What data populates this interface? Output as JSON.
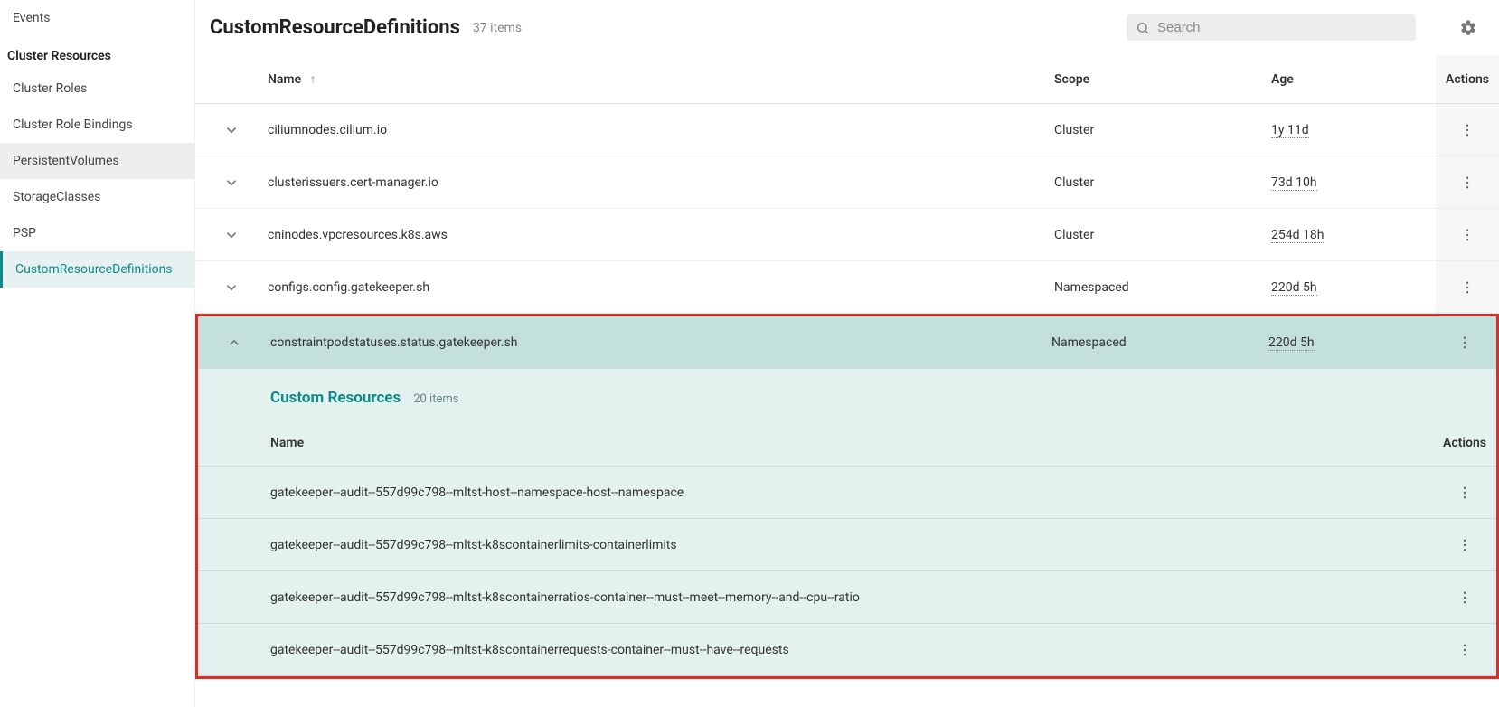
{
  "sidebar": {
    "events": "Events",
    "section": "Cluster Resources",
    "items": [
      {
        "label": "Cluster Roles",
        "active": false,
        "highlight": false
      },
      {
        "label": "Cluster Role Bindings",
        "active": false,
        "highlight": false
      },
      {
        "label": "PersistentVolumes",
        "active": false,
        "highlight": true
      },
      {
        "label": "StorageClasses",
        "active": false,
        "highlight": false
      },
      {
        "label": "PSP",
        "active": false,
        "highlight": false
      },
      {
        "label": "CustomResourceDefinitions",
        "active": true,
        "highlight": false
      }
    ]
  },
  "header": {
    "title": "CustomResourceDefinitions",
    "count": "37 items",
    "search_placeholder": "Search"
  },
  "columns": {
    "name": "Name",
    "scope": "Scope",
    "age": "Age",
    "actions": "Actions"
  },
  "rows": [
    {
      "name": "ciliumnodes.cilium.io",
      "scope": "Cluster",
      "age": "1y 11d",
      "expanded": false
    },
    {
      "name": "clusterissuers.cert-manager.io",
      "scope": "Cluster",
      "age": "73d 10h",
      "expanded": false
    },
    {
      "name": "cninodes.vpcresources.k8s.aws",
      "scope": "Cluster",
      "age": "254d 18h",
      "expanded": false
    },
    {
      "name": "configs.config.gatekeeper.sh",
      "scope": "Namespaced",
      "age": "220d 5h",
      "expanded": false
    },
    {
      "name": "constraintpodstatuses.status.gatekeeper.sh",
      "scope": "Namespaced",
      "age": "220d 5h",
      "expanded": true
    }
  ],
  "nested": {
    "title": "Custom Resources",
    "count": "20 items",
    "columns": {
      "name": "Name",
      "actions": "Actions"
    },
    "rows": [
      {
        "name": "gatekeeper--audit--557d99c798--mltst-host--namespace-host--namespace"
      },
      {
        "name": "gatekeeper--audit--557d99c798--mltst-k8scontainerlimits-containerlimits"
      },
      {
        "name": "gatekeeper--audit--557d99c798--mltst-k8scontainerratios-container--must--meet--memory--and--cpu--ratio"
      },
      {
        "name": "gatekeeper--audit--557d99c798--mltst-k8scontainerrequests-container--must--have--requests"
      }
    ]
  }
}
